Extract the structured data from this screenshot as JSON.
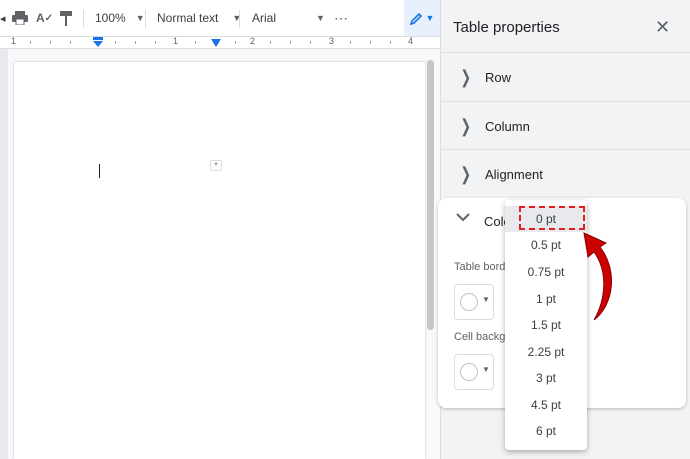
{
  "toolbar": {
    "zoom": "100%",
    "style": "Normal text",
    "font": "Arial",
    "more": "⋯"
  },
  "ruler": {
    "numbers": [
      "1",
      "1",
      "2",
      "3",
      "4"
    ]
  },
  "panel": {
    "title": "Table properties",
    "sections": [
      "Row",
      "Column",
      "Alignment"
    ],
    "color_section": "Colo",
    "table_border_label": "Table borde",
    "cell_background_label": "Cell backgr"
  },
  "border_width_options": [
    "0 pt",
    "0.5 pt",
    "0.75 pt",
    "1 pt",
    "1.5 pt",
    "2.25 pt",
    "3 pt",
    "4.5 pt",
    "6 pt"
  ],
  "selected_option": "0 pt",
  "colors": {
    "accent": "#1a73e8",
    "highlight": "#e21f1f",
    "arrow": "#cc0000"
  },
  "icons": [
    "print-icon",
    "spellcheck-icon",
    "paint-format-icon",
    "edit-pencil-icon",
    "close-icon",
    "chevron-right-icon",
    "chevron-down-icon"
  ]
}
